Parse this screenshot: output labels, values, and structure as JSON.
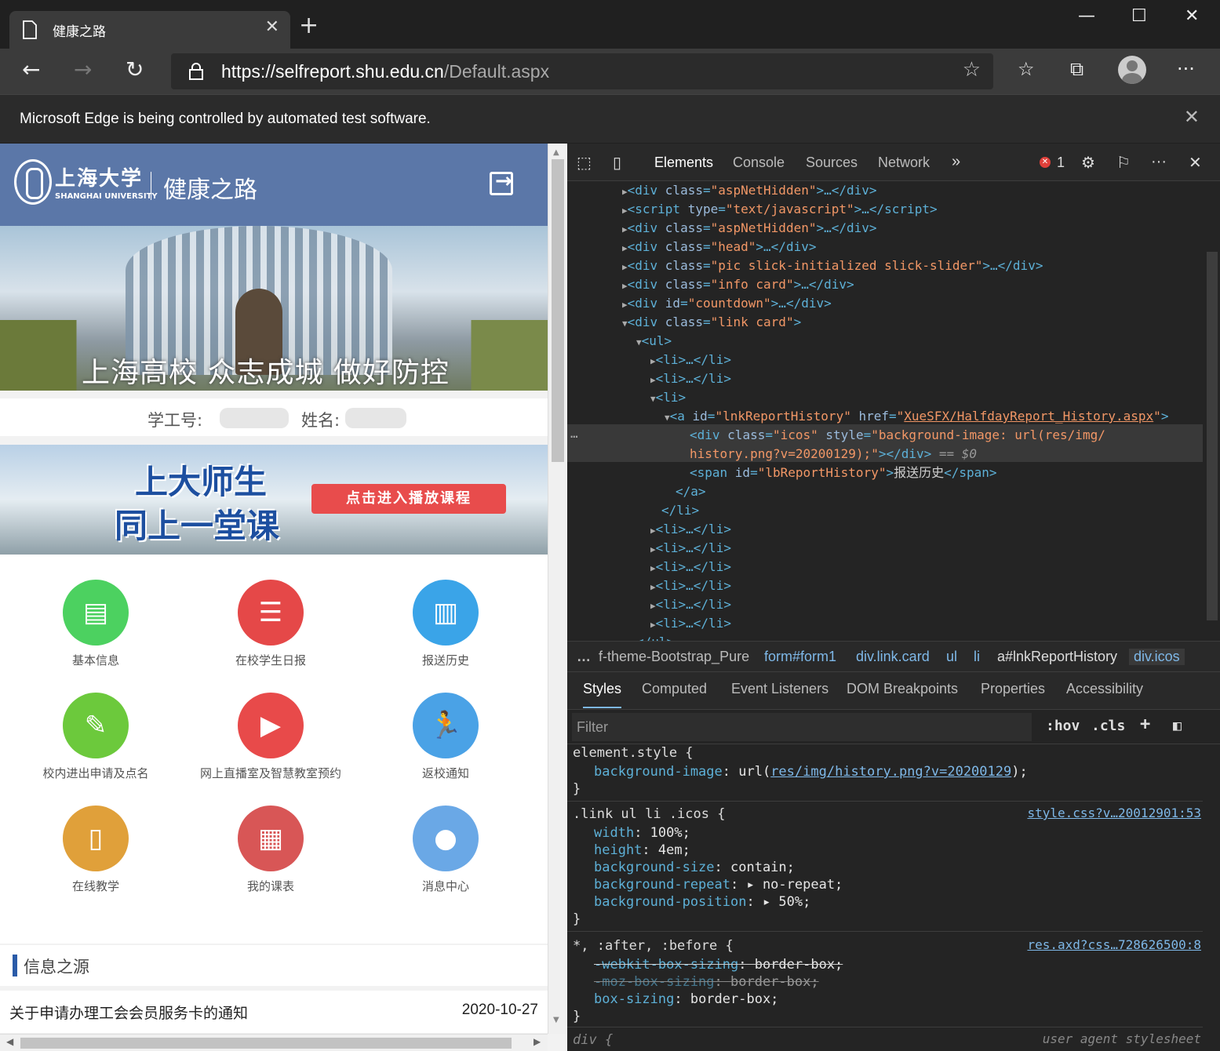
{
  "browser": {
    "tab_title": "健康之路",
    "url_main": "https://selfreport.shu.edu.cn",
    "url_path": "/Default.aspx",
    "infobar": "Microsoft Edge is being controlled by automated test software."
  },
  "page": {
    "logo_cn": "上海大学",
    "logo_en": "SHANGHAI UNIVERSITY",
    "site_title": "健康之路",
    "banner_slogan": "上海高校 众志成城 做好防控",
    "student_id_label": "学工号:",
    "name_label": "姓名:",
    "promo_line1": "上大师生",
    "promo_line2": "同上一堂课",
    "promo_cta": "点击进入播放课程",
    "tiles": [
      {
        "label": "基本信息",
        "color": "#4cd160",
        "icon": "form-icon"
      },
      {
        "label": "在校学生日报",
        "color": "#e54848",
        "icon": "report-icon"
      },
      {
        "label": "报送历史",
        "color": "#3aa4e8",
        "icon": "history-icon"
      },
      {
        "label": "校内进出申请及点名",
        "color": "#6cc93c",
        "icon": "sign-icon"
      },
      {
        "label": "网上直播室及智慧教室预约",
        "color": "#e84a4a",
        "icon": "video-icon"
      },
      {
        "label": "返校通知",
        "color": "#4aa2e6",
        "icon": "runner-icon"
      },
      {
        "label": "在线教学",
        "color": "#e0a03a",
        "icon": "book-icon"
      },
      {
        "label": "我的课表",
        "color": "#d85656",
        "icon": "calendar-icon"
      },
      {
        "label": "消息中心",
        "color": "#6aa8e6",
        "icon": "chat-icon"
      }
    ],
    "section_title": "信息之源",
    "news": [
      {
        "title": "关于申请办理工会会员服务卡的通知",
        "date": "2020-10-27"
      }
    ]
  },
  "devtools": {
    "tabs": [
      "Elements",
      "Console",
      "Sources",
      "Network"
    ],
    "error_count": "1",
    "breadcrumbs": [
      "…",
      "f-theme-Bootstrap_Pure",
      "form#form1",
      "div.link.card",
      "ul",
      "li",
      "a#lnkReportHistory",
      "div.icos"
    ],
    "style_tabs": [
      "Styles",
      "Computed",
      "Event Listeners",
      "DOM Breakpoints",
      "Properties",
      "Accessibility"
    ],
    "filter_placeholder": "Filter",
    "hov": ":hov",
    "cls": ".cls",
    "span_text": "报送历史",
    "href": "XueSFX/HalfdayReport_History.aspx",
    "bg_url": "res/img/history.png?v=20200129",
    "src1": "style.css?v…20012901:53",
    "src2": "res.axd?css…728626500:8",
    "src3": "user agent stylesheet"
  }
}
